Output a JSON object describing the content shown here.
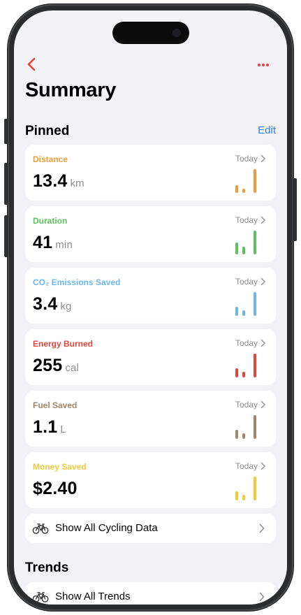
{
  "nav": {
    "back_icon": "chevron-left-icon",
    "more_icon": "ellipsis-icon",
    "accent": "#e0443b"
  },
  "title": "Summary",
  "pinned": {
    "heading": "Pinned",
    "edit_label": "Edit",
    "cards": [
      {
        "label": "Distance",
        "period": "Today",
        "value": "13.4",
        "unit": "km",
        "color": "#f09a37",
        "bar_levels": [
          0.3,
          0.15,
          0.9
        ]
      },
      {
        "label": "Duration",
        "period": "Today",
        "value": "41",
        "unit": "min",
        "color": "#5bc35e",
        "bar_levels": [
          0.45,
          0.3,
          0.9
        ]
      },
      {
        "label": "CO₂ Emissions Saved",
        "period": "Today",
        "value": "3.4",
        "unit": "kg",
        "color": "#6ab8ea",
        "bar_levels": [
          0.35,
          0.2,
          0.9
        ]
      },
      {
        "label": "Energy Burned",
        "period": "Today",
        "value": "255",
        "unit": "cal",
        "color": "#e0443b",
        "bar_levels": [
          0.35,
          0.2,
          0.9
        ]
      },
      {
        "label": "Fuel Saved",
        "period": "Today",
        "value": "1.1",
        "unit": "L",
        "color": "#a28669",
        "bar_levels": [
          0.35,
          0.2,
          0.9
        ]
      },
      {
        "label": "Money Saved",
        "period": "Today",
        "value": "$2.40",
        "unit": "",
        "color": "#f3c93c",
        "bar_levels": [
          0.35,
          0.2,
          0.9
        ]
      }
    ]
  },
  "show_all_cycling": {
    "label": "Show All Cycling Data",
    "icon": "bicycle-icon"
  },
  "trends": {
    "heading": "Trends",
    "show_all_label": "Show All Trends",
    "icon": "bicycle-icon"
  }
}
